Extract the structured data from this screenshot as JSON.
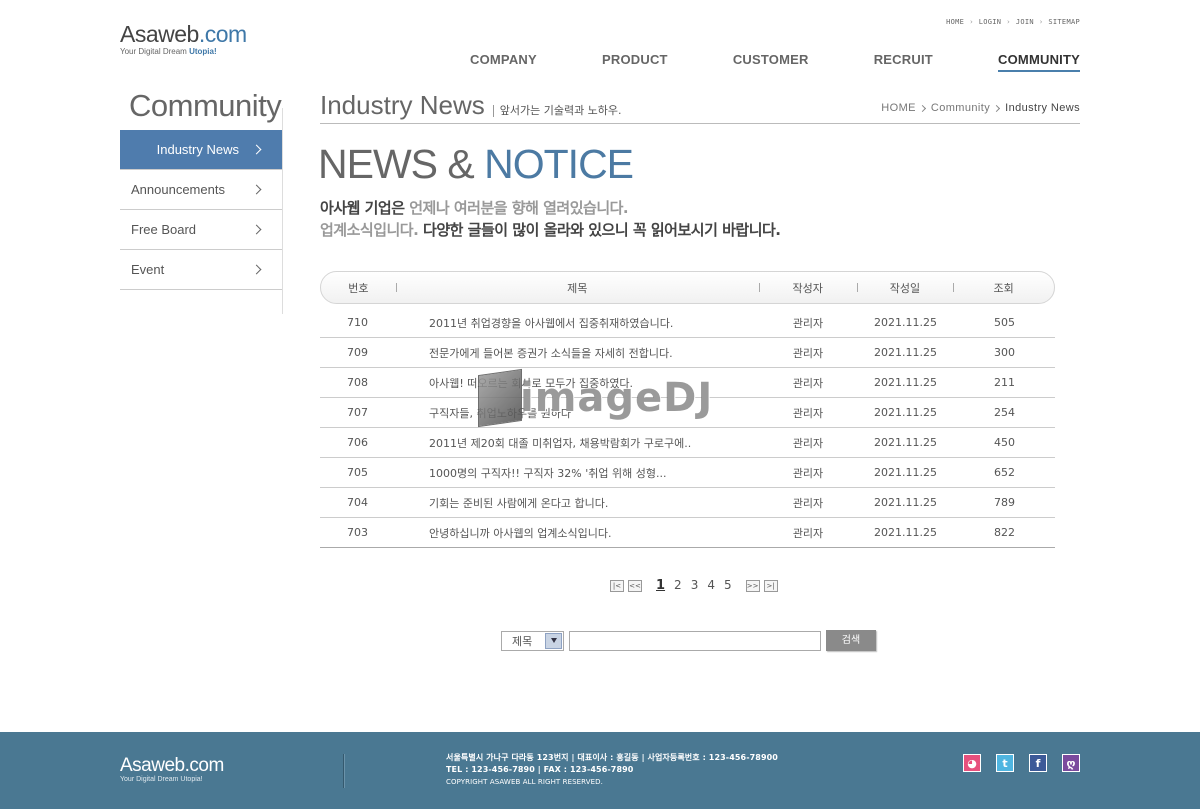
{
  "header": {
    "brand_main": "Asaweb",
    "brand_dot": ".com",
    "tagline_prefix": "Your Digital Dream ",
    "tagline_emph": "Utopia!",
    "util_nav": [
      "HOME",
      "LOGIN",
      "JOIN",
      "SITEMAP"
    ],
    "gnb": [
      "COMPANY",
      "PRODUCT",
      "CUSTOMER",
      "RECRUIT",
      "COMMUNITY"
    ]
  },
  "sidebar": {
    "title": "Community",
    "items": [
      "Industry News",
      "Announcements",
      "Free Board",
      "Event"
    ]
  },
  "content": {
    "title": "Industry News",
    "subtitle": "앞서가는 기술력과 노하우.",
    "breadcrumb": [
      "HOME",
      "Community",
      "Industry News"
    ],
    "hero_a": "NEWS & ",
    "hero_b": "NOTICE",
    "desc_l1_a": "아사웹 기업은 ",
    "desc_l1_b": "언제나 여러분을 향해 열려있습니다.",
    "desc_l2_a": "업계소식입니다. ",
    "desc_l2_b": "다양한 글들이 많이 올라와 있으니 꼭 읽어보시기 바랍니다."
  },
  "board": {
    "columns": [
      "번호",
      "제목",
      "작성자",
      "작성일",
      "조회"
    ],
    "rows": [
      {
        "no": "710",
        "title": "2011년 취업경향을 아사웹에서 집중취재하였습니다.",
        "writer": "관리자",
        "date": "2021.11.25",
        "views": "505"
      },
      {
        "no": "709",
        "title": "전문가에게 들어본 증권가 소식들을 자세히 전합니다.",
        "writer": "관리자",
        "date": "2021.11.25",
        "views": "300"
      },
      {
        "no": "708",
        "title": "아사웹! 떠오르는 회사로 모두가 집중하였다.",
        "writer": "관리자",
        "date": "2021.11.25",
        "views": "211"
      },
      {
        "no": "707",
        "title": "구직자들, 취업노하우를 원하다",
        "writer": "관리자",
        "date": "2021.11.25",
        "views": "254"
      },
      {
        "no": "706",
        "title": "2011년 제20회 대졸 미취업자, 채용박람회가 구로구에..",
        "writer": "관리자",
        "date": "2021.11.25",
        "views": "450"
      },
      {
        "no": "705",
        "title": "1000명의 구직자!! 구직자 32% '취업 위해 성형...",
        "writer": "관리자",
        "date": "2021.11.25",
        "views": "652"
      },
      {
        "no": "704",
        "title": "기회는 준비된 사람에게 온다고 합니다.",
        "writer": "관리자",
        "date": "2021.11.25",
        "views": "789"
      },
      {
        "no": "703",
        "title": "안녕하십니까 아사웹의 업계소식입니다.",
        "writer": "관리자",
        "date": "2021.11.25",
        "views": "822"
      }
    ]
  },
  "watermark": "imageDJ",
  "pagination": {
    "first": "|<",
    "prev": "<<",
    "pages": [
      "1",
      "2",
      "3",
      "4",
      "5"
    ],
    "current": "1",
    "next": ">>",
    "last": ">|"
  },
  "search": {
    "select_value": "제목",
    "input_value": "",
    "button": "검색"
  },
  "footer": {
    "brand": "Asaweb.com",
    "tagline": "Your Digital Dream Utopia!",
    "line1": "서울특별시 가나구 다라동 123번지  |  대표이사 : 홍길동  |  사업자등록번호 : 123-456-78900",
    "line2": "TEL : 123-456-7890  |  FAX : 123-456-7890",
    "copyright": "COPYRIGHT ASAWEB ALL RIGHT RESERVED.",
    "sns": [
      {
        "icon": "me2day-icon",
        "glyph": "◕"
      },
      {
        "icon": "twitter-icon",
        "glyph": "t"
      },
      {
        "icon": "facebook-icon",
        "glyph": "f"
      },
      {
        "icon": "yozm-icon",
        "glyph": "ღ"
      }
    ],
    "colors": {
      "bg": "#4a7892",
      "accent": "#4f7cad"
    }
  }
}
